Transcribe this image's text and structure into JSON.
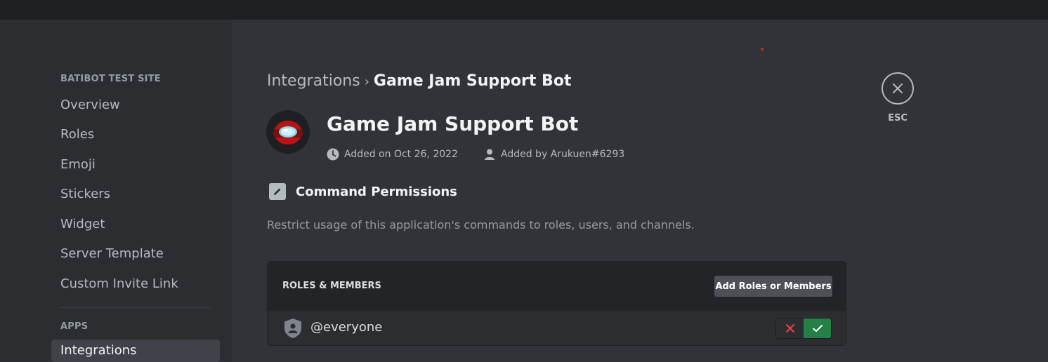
{
  "sidebar": {
    "server_header": "BATIBOT TEST SITE",
    "items": [
      {
        "label": "Overview"
      },
      {
        "label": "Roles"
      },
      {
        "label": "Emoji"
      },
      {
        "label": "Stickers"
      },
      {
        "label": "Widget"
      },
      {
        "label": "Server Template"
      },
      {
        "label": "Custom Invite Link"
      }
    ],
    "apps_header": "APPS",
    "apps_items": [
      {
        "label": "Integrations",
        "selected": true
      }
    ]
  },
  "breadcrumb": {
    "parent": "Integrations",
    "current": "Game Jam Support Bot"
  },
  "app": {
    "name": "Game Jam Support Bot",
    "added_on": "Added on Oct 26, 2022",
    "added_by": "Added by Arukuen#6293",
    "avatar_icon": "among-us-red-crewmate-icon"
  },
  "permissions": {
    "title": "Command Permissions",
    "description": "Restrict usage of this application's commands to roles, users, and channels.",
    "panel_header": "ROLES & MEMBERS",
    "add_button": "Add Roles or Members",
    "rows": [
      {
        "name": "@everyone",
        "state": "allowed"
      }
    ]
  },
  "close": {
    "esc_label": "ESC"
  },
  "colors": {
    "allow": "#248046",
    "deny": "#f23f42",
    "background": "#313338",
    "sidebar": "#2b2d31"
  }
}
